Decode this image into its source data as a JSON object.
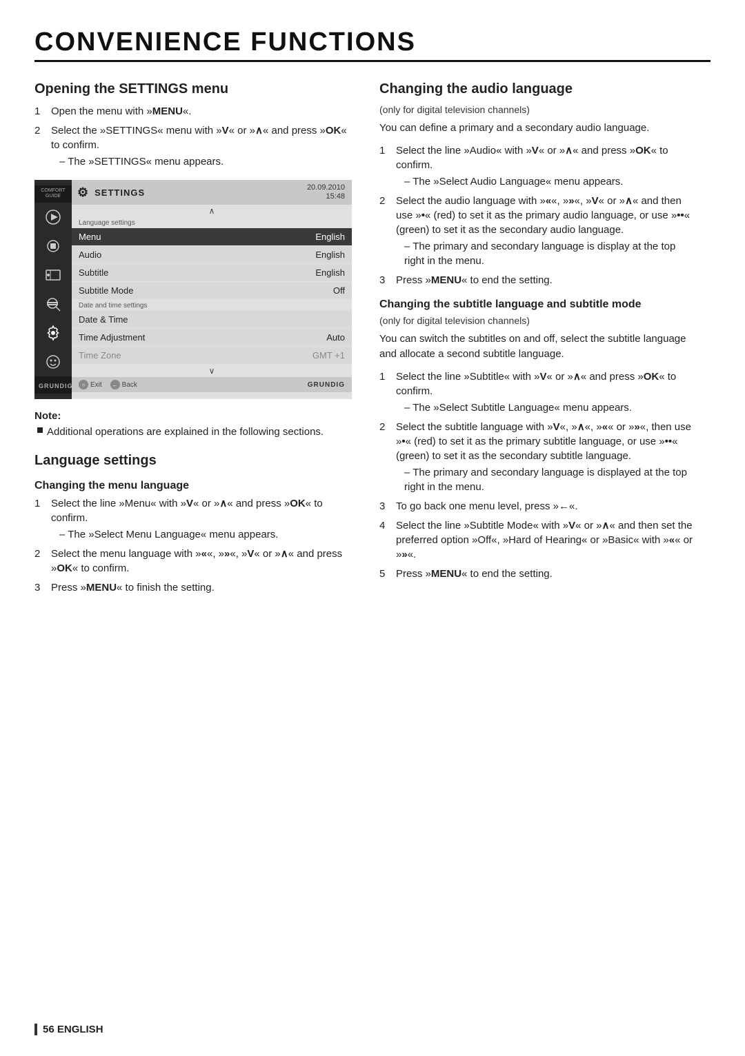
{
  "page": {
    "title": "CONVENIENCE FUNCTIONS",
    "footer": "56  ENGLISH"
  },
  "left_col": {
    "opening_section": {
      "title": "Opening the SETTINGS menu",
      "steps": [
        {
          "num": "1",
          "text": "Open the menu with »<b>MENU</b>«."
        },
        {
          "num": "2",
          "text": "Select the »SETTINGS« menu with »<b>V</b>« or »<b>∧</b>« and press »<b>OK</b>« to confirm.",
          "sub": "– The »SETTINGS« menu appears."
        }
      ]
    },
    "note": {
      "title": "Note:",
      "item": "Additional operations are explained in the following sections."
    },
    "language_section": {
      "title": "Language settings",
      "menu_subsection": {
        "title": "Changing the menu language",
        "steps": [
          {
            "num": "1",
            "text": "Select the line »Menu« with »<b>V</b>« or »<b>∧</b>« and press »<b>OK</b>« to confirm.",
            "sub": "– The »Select Menu Language« menu appears."
          },
          {
            "num": "2",
            "text": "Select the menu language with »<b>«</b>«, »<b>»</b>«, »<b>V</b>« or »<b>∧</b>« and press »<b>OK</b>« to confirm."
          },
          {
            "num": "3",
            "text": "Press »<b>MENU</b>« to finish the setting."
          }
        ]
      }
    }
  },
  "right_col": {
    "audio_section": {
      "title": "Changing the audio language",
      "note": "(only for digital television channels)",
      "intro": "You can define a primary and a secondary audio language.",
      "steps": [
        {
          "num": "1",
          "text": "Select the line »Audio« with »<b>V</b>« or »<b>∧</b>« and press »<b>OK</b>« to confirm.",
          "sub": "– The »Select Audio Language« menu appears."
        },
        {
          "num": "2",
          "text": "Select the audio language with »<b>«</b>«, »<b>»</b>«, »<b>V</b>« or »<b>∧</b>« and then use »<b>•</b>« (red) to set it as the primary audio language, or use »<b>••</b>« (green) to set it as the secondary audio language.",
          "sub": "– The primary and secondary language is display at the top right in the menu."
        },
        {
          "num": "3",
          "text": "Press »<b>MENU</b>« to end the setting."
        }
      ]
    },
    "subtitle_section": {
      "title": "Changing the subtitle language and subtitle mode",
      "note": "(only for digital television channels)",
      "intro": "You can switch the subtitles on and off, select the subtitle language and allocate a second subtitle language.",
      "steps": [
        {
          "num": "1",
          "text": "Select the line »Subtitle« with »<b>V</b>« or »<b>∧</b>« and press »<b>OK</b>« to confirm.",
          "sub": "– The »Select Subtitle Language« menu appears."
        },
        {
          "num": "2",
          "text": "Select the subtitle language with »<b>V</b>«, »<b>∧</b>«, »<b>«</b>« or »<b>»</b>«, then use »<b>•</b>« (red) to set it as the primary subtitle language, or use »<b>••</b>« (green) to set it as the secondary subtitle language.",
          "sub": "– The primary and secondary language is displayed at the top right in the menu."
        },
        {
          "num": "3",
          "text": "To go back one menu level, press »<b>←</b>«."
        },
        {
          "num": "4",
          "text": "Select the line »Subtitle Mode« with »<b>V</b>« or »<b>∧</b>« and then set the preferred option »Off«, »Hard of Hearing« or »Basic« with »<b>«</b>« or »<b>»</b>«."
        },
        {
          "num": "5",
          "text": "Press »<b>MENU</b>« to end the setting."
        }
      ]
    }
  },
  "tv_menu": {
    "date": "20.09.2010",
    "time": "15:48",
    "title": "SETTINGS",
    "section_label_lang": "Language settings",
    "section_label_date": "Date and time settings",
    "rows": [
      {
        "label": "Menu",
        "value": "English",
        "highlighted": true
      },
      {
        "label": "Audio",
        "value": "English",
        "highlighted": false
      },
      {
        "label": "Subtitle",
        "value": "English",
        "highlighted": false
      },
      {
        "label": "Subtitle Mode",
        "value": "Off",
        "highlighted": false
      },
      {
        "label": "Date & Time",
        "value": "",
        "highlighted": false
      },
      {
        "label": "Time Adjustment",
        "value": "Auto",
        "highlighted": false
      },
      {
        "label": "Time Zone",
        "value": "GMT +1",
        "highlighted": false,
        "dimmed": true
      }
    ],
    "exit_label": "Exit",
    "back_label": "Back",
    "logo": "GRUNDIG"
  }
}
